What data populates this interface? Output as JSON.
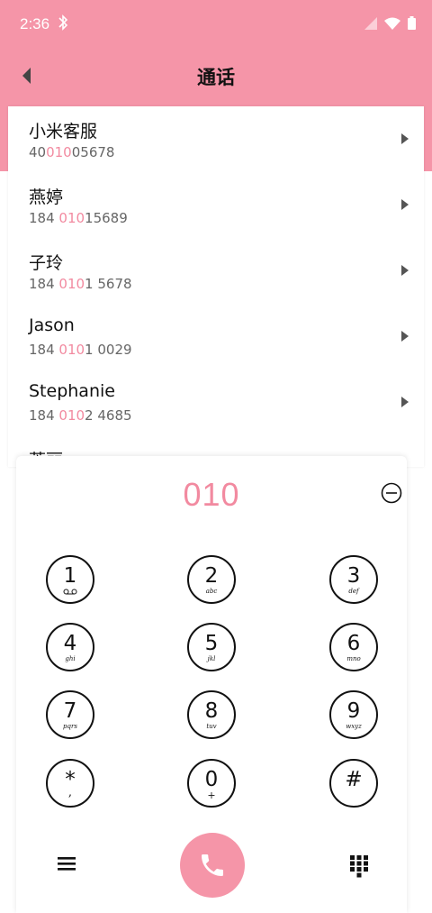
{
  "status_bar": {
    "time": "2:36"
  },
  "header": {
    "title": "通话"
  },
  "contacts": [
    {
      "name": "小米客服",
      "num_pre": "40",
      "num_hl": "010",
      "num_post": "05678"
    },
    {
      "name": "燕婷",
      "num_pre": "184 ",
      "num_hl": "010",
      "num_post": "15689"
    },
    {
      "name": "子玲",
      "num_pre": "184 ",
      "num_hl": "010",
      "num_post": "1 5678"
    },
    {
      "name": "Jason",
      "num_pre": "184 ",
      "num_hl": "010",
      "num_post": "1 0029"
    },
    {
      "name": "Stephanie",
      "num_pre": "184 ",
      "num_hl": "010",
      "num_post": "2 4685"
    },
    {
      "name": "蒂丽",
      "num_pre": "",
      "num_hl": "",
      "num_post": ""
    }
  ],
  "dialer": {
    "value": "010",
    "keys": [
      {
        "digit": "1",
        "letters": ""
      },
      {
        "digit": "2",
        "letters": "abc"
      },
      {
        "digit": "3",
        "letters": "def"
      },
      {
        "digit": "4",
        "letters": "ghi"
      },
      {
        "digit": "5",
        "letters": "jkl"
      },
      {
        "digit": "6",
        "letters": "mno"
      },
      {
        "digit": "7",
        "letters": "pqrs"
      },
      {
        "digit": "8",
        "letters": "tuv"
      },
      {
        "digit": "9",
        "letters": "wxyz"
      },
      {
        "digit": "*",
        "letters": ","
      },
      {
        "digit": "0",
        "letters": "+"
      },
      {
        "digit": "#",
        "letters": ""
      }
    ]
  },
  "colors": {
    "accent": "#f595a8",
    "highlight": "#f28aa0"
  },
  "icons": [
    "bluetooth-icon",
    "signal-icon",
    "wifi-icon",
    "battery-icon",
    "back-icon",
    "delete-icon",
    "voicemail-icon",
    "menu-icon",
    "phone-icon",
    "keypad-icon"
  ]
}
